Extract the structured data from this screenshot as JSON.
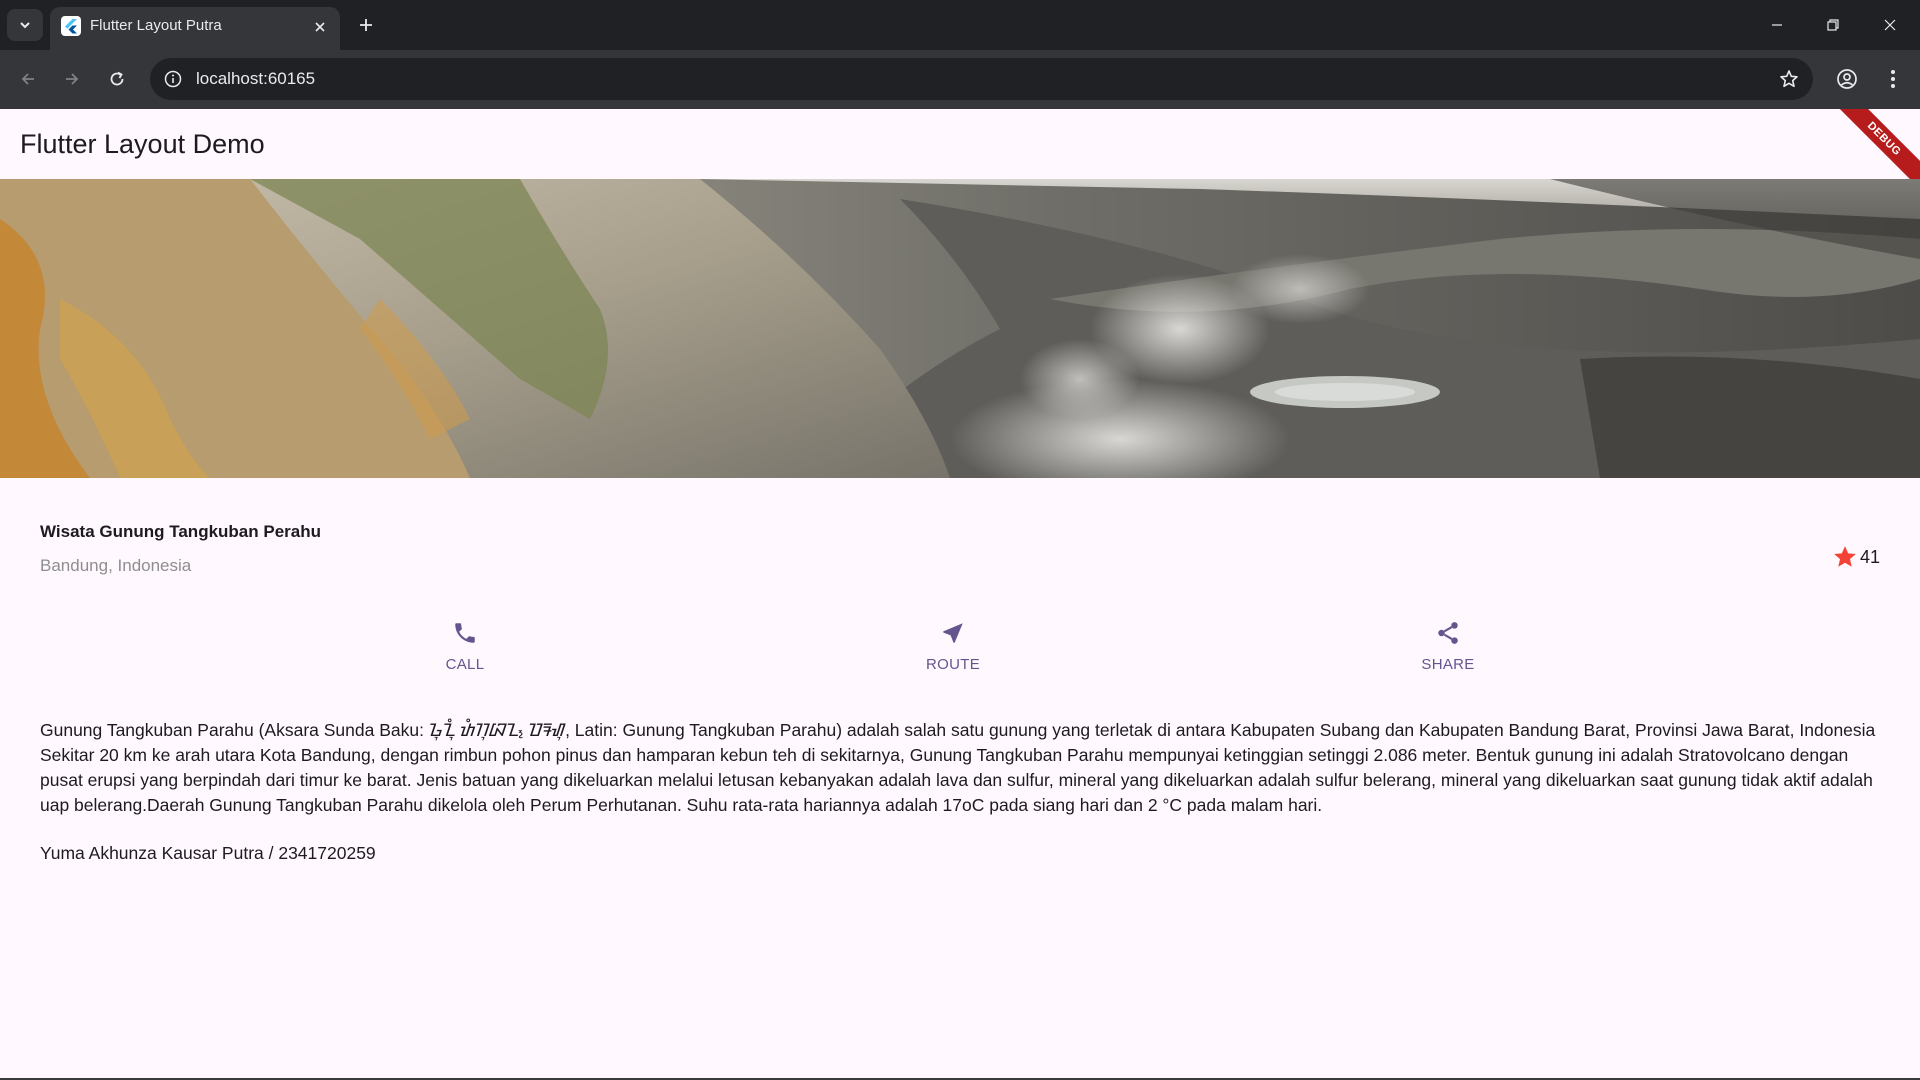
{
  "browser": {
    "tab_title": "Flutter Layout Putra",
    "url": "localhost:60165"
  },
  "app": {
    "appbar_title": "Flutter Layout Demo",
    "debug_banner": "DEBUG",
    "place": {
      "name": "Wisata Gunung Tangkuban Perahu",
      "location": "Bandung, Indonesia",
      "favorite_count": "41",
      "star_color": "#f44336"
    },
    "actions": [
      {
        "label": "CALL",
        "icon": "phone-icon"
      },
      {
        "label": "ROUTE",
        "icon": "near-me-icon"
      },
      {
        "label": "SHARE",
        "icon": "share-icon"
      }
    ],
    "accent_color": "#65558f",
    "description": "Gunung Tangkuban Parahu (Aksara Sunda Baku: ᮌᮥᮔᮥᮀ ᮒᮀᮊᮥᮘᮔ᮪ ᮕᮛᮠᮥ, Latin: Gunung Tangkuban Parahu) adalah salah satu gunung yang terletak di antara Kabupaten Subang dan Kabupaten Bandung Barat, Provinsi Jawa Barat, Indonesia Sekitar 20 km ke arah utara Kota Bandung, dengan rimbun pohon pinus dan hamparan kebun teh di sekitarnya, Gunung Tangkuban Parahu mempunyai ketinggian setinggi 2.086 meter. Bentuk gunung ini adalah Stratovolcano dengan pusat erupsi yang berpindah dari timur ke barat. Jenis batuan yang dikeluarkan melalui letusan kebanyakan adalah lava dan sulfur, mineral yang dikeluarkan adalah sulfur belerang, mineral yang dikeluarkan saat gunung tidak aktif adalah uap belerang.Daerah Gunung Tangkuban Parahu dikelola oleh Perum Perhutanan. Suhu rata-rata hariannya adalah 17oC pada siang hari dan 2 °C pada malam hari.",
    "author": "Yuma Akhunza Kausar Putra / 2341720259"
  }
}
